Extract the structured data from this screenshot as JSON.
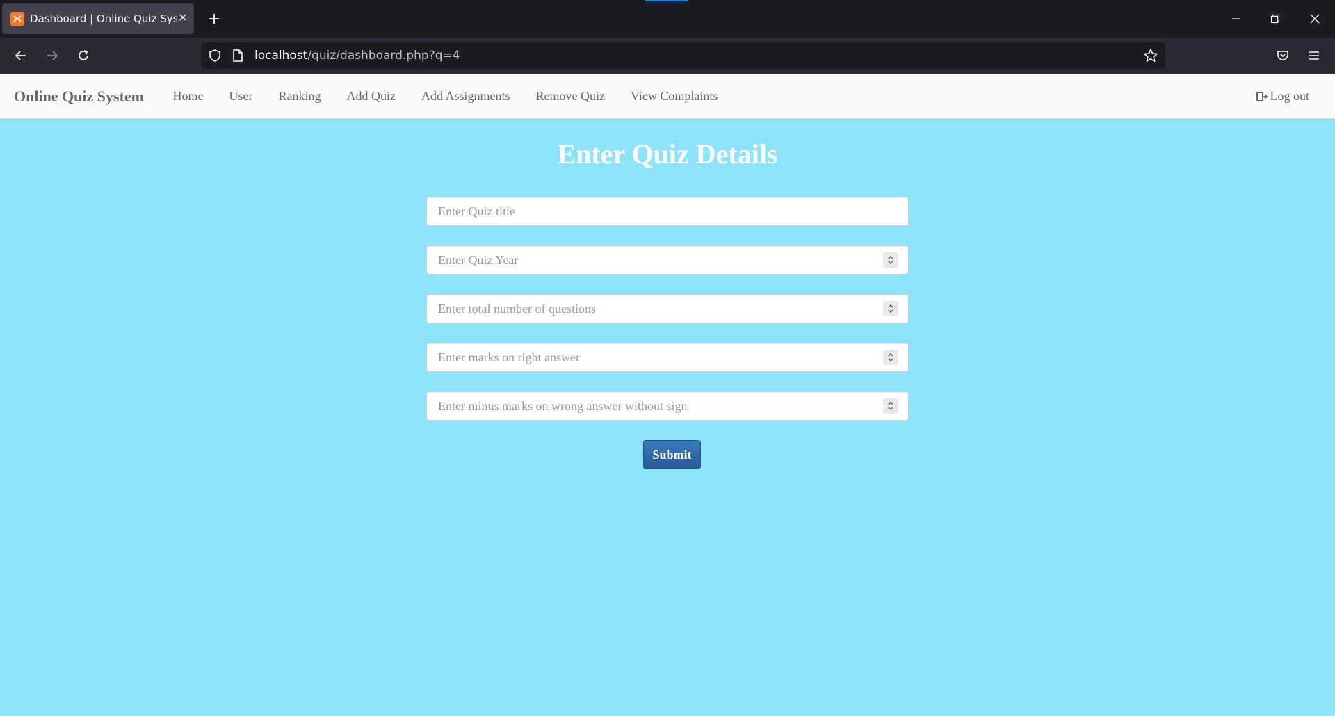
{
  "browser": {
    "tab_title": "Dashboard | Online Quiz System",
    "url_host": "localhost",
    "url_path": "/quiz/dashboard.php?q=4",
    "icons": {
      "favicon": "xampp-icon",
      "tab_close": "close-icon",
      "new_tab": "plus-icon",
      "back": "arrow-left-icon",
      "forward": "arrow-right-icon",
      "reload": "reload-icon",
      "shield": "shield-icon",
      "page": "page-icon",
      "bookmark": "star-icon",
      "pocket": "pocket-icon",
      "menu": "hamburger-menu-icon"
    }
  },
  "site": {
    "brand": "Online Quiz System",
    "nav": [
      {
        "label": "Home"
      },
      {
        "label": "User"
      },
      {
        "label": "Ranking"
      },
      {
        "label": "Add Quiz"
      },
      {
        "label": "Add Assignments"
      },
      {
        "label": "Remove Quiz"
      },
      {
        "label": "View Complaints"
      }
    ],
    "logout_label": "Log out"
  },
  "form": {
    "heading": "Enter Quiz Details",
    "fields": [
      {
        "placeholder": "Enter Quiz title",
        "type": "text"
      },
      {
        "placeholder": "Enter Quiz Year",
        "type": "number"
      },
      {
        "placeholder": "Enter total number of questions",
        "type": "number"
      },
      {
        "placeholder": "Enter marks on right answer",
        "type": "number"
      },
      {
        "placeholder": "Enter minus marks on wrong answer without sign",
        "type": "number"
      }
    ],
    "submit_label": "Submit"
  },
  "colors": {
    "page_background": "#8de3fc",
    "heading": "#ffffff",
    "submit_button": "#2e6da4",
    "browser_dark": "#1c1b22"
  }
}
